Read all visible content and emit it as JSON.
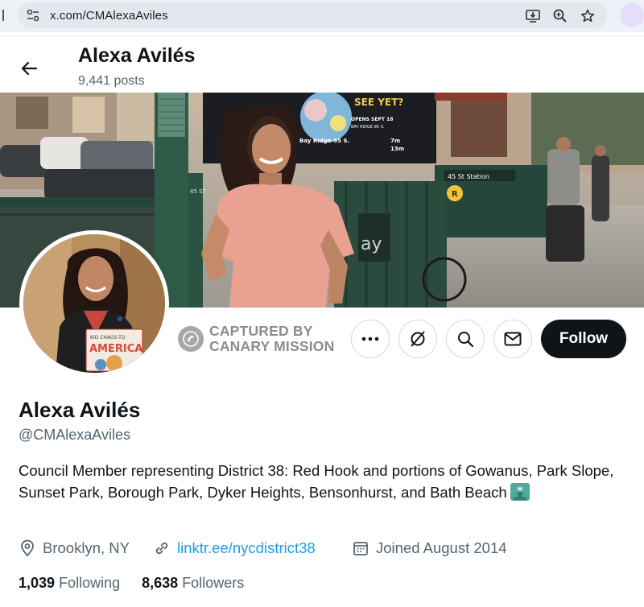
{
  "browser": {
    "url": "x.com/CMAlexaAviles"
  },
  "header": {
    "name": "Alexa Avilés",
    "posts": "9,441 posts"
  },
  "banner": {
    "sign_main": "SEE YET?",
    "sign_line1": "OPENS SEPT 18",
    "sign_line2": "BAY RIDGE-95 S.",
    "sign_line3": "Bay Ridge-95 S.",
    "sign_time1": "7m",
    "sign_time2": "13m",
    "station": "45 St Station",
    "station_letter": "R",
    "pole_text": "45 ST",
    "side_text": "ay"
  },
  "avatar": {
    "book_line1": "KID CHAOS-TO",
    "book_line2": "AMERICA"
  },
  "captured": {
    "line1": "CAPTURED BY",
    "line2": "CANARY MISSION"
  },
  "actions": {
    "follow_label": "Follow"
  },
  "profile": {
    "name": "Alexa Avilés",
    "handle": "@CMAlexaAviles",
    "bio": "Council Member representing District 38: Red Hook and portions of Gowanus, Park Slope, Sunset Park, Borough Park, Dyker Heights, Bensonhurst, and Bath Beach",
    "location": "Brooklyn, NY",
    "link": "linktr.ee/nycdistrict38",
    "joined": "Joined August 2014",
    "following_count": "1,039",
    "following_label": "Following",
    "followers_count": "8,638",
    "followers_label": "Followers"
  },
  "colors": {
    "accent": "#1d9bf0",
    "follow_bg": "#0f1419",
    "secondary_text": "#536471"
  }
}
